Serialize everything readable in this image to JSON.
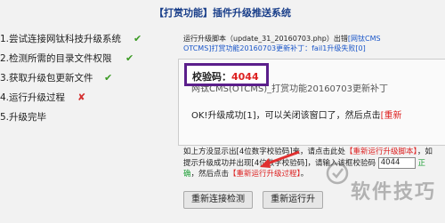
{
  "header": {
    "title": "【打赏功能】插件升级推送系统"
  },
  "steps": [
    {
      "label": "1.尝试连接网钛科技升级系统",
      "status": "done"
    },
    {
      "label": "2.检测所需的目录文件权限",
      "status": "done"
    },
    {
      "label": "3.获取升级包更新文件",
      "status": "done"
    },
    {
      "label": "4.运行升级过程",
      "status": "failed"
    },
    {
      "label": "5.升级完毕",
      "status": "pending"
    }
  ],
  "log": {
    "line1_prefix": "运行升级脚本（update_31_20160703.php）出错",
    "line1_link": "[网钛CMS",
    "line2": "OTCMS]打赏功能20160703更新补丁：fail1升级失败[0]"
  },
  "result_box": {
    "code_label": "校验码：",
    "code_value": "4044",
    "title": "网钛CMS(OTCMS)_打赏功能20160703更新补丁",
    "ok_text": "OK!升级成功[1]，可以关闭该窗口了，然后点击",
    "ok_link": "[重新"
  },
  "info": {
    "text1": "如上方没显示出[4位数字校验码]来，请点击此处",
    "link1": "【重新运行升级脚本】",
    "text2": "，如提示升级成功并出现[4位数字校验码]，请输入该框",
    "code_label": "校验码",
    "code_value": "4044",
    "ok_label": "正确",
    "text3": "，然后点击",
    "link2": "【重新运行升级过程】",
    "text4": "。"
  },
  "buttons": {
    "reconnect": "重新连接检测",
    "rerun": "重新运行升"
  },
  "watermark": {
    "text": "软件技巧"
  },
  "colors": {
    "title": "#1a3f8a",
    "accent_red": "#d22222",
    "check_green": "#3a9a23",
    "callout_border": "#5b1f8b"
  }
}
